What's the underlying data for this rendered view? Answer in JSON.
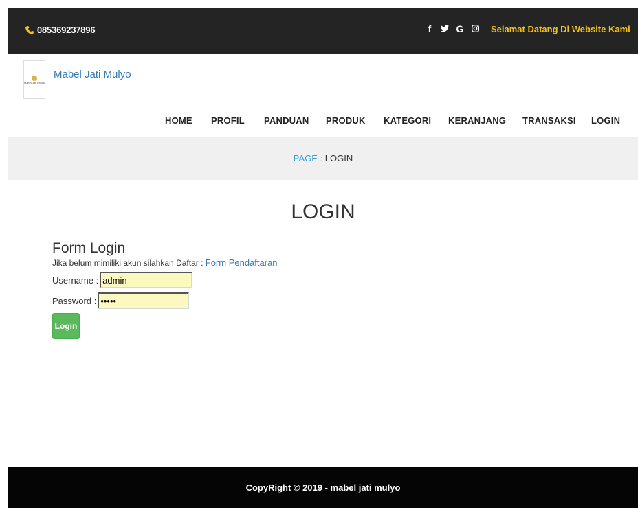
{
  "topbar": {
    "phone": "085369237896",
    "social_icons": [
      {
        "icon": "facebook-icon",
        "glyph": "f"
      },
      {
        "icon": "twitter-icon",
        "glyph": "🐦"
      },
      {
        "icon": "google-icon",
        "glyph": "G"
      },
      {
        "icon": "instagram-icon",
        "glyph": "◎"
      }
    ],
    "welcome": "Selamat Datang Di Website Kami"
  },
  "brand": {
    "logo_text": "Mabel Jati Mulyo",
    "name": "Mabel Jati Mulyo"
  },
  "nav": {
    "home": "HOME",
    "profil": "PROFIL",
    "panduan": "PANDUAN",
    "produk": "PRODUK",
    "kategori": "KATEGORI",
    "keranjang": "KERANJANG",
    "transaksi": "TRANSAKSI",
    "login": "LOGIN"
  },
  "page_bar": {
    "prefix": "PAGE :",
    "name": "LOGIN"
  },
  "heading": "LOGIN",
  "form": {
    "title": "Form Login",
    "description": "Jika belum mimiliki akun silahkan Daftar :",
    "register_link": "Form Pendaftaran",
    "username_label": "Username :",
    "username_value": "admin",
    "password_label": "Password :",
    "password_value": "admin",
    "submit_label": "Login"
  },
  "footer": {
    "copyright": "CopyRight © 2019 - mabel jati mulyo"
  },
  "colors": {
    "topbar_bg": "#242424",
    "welcome_text": "#f0c11a",
    "link": "#337ab7",
    "page_prefix": "#3aa0d8",
    "button": "#5cb85c",
    "input_bg": "#fbf9c0",
    "footer_bg": "#050505"
  }
}
